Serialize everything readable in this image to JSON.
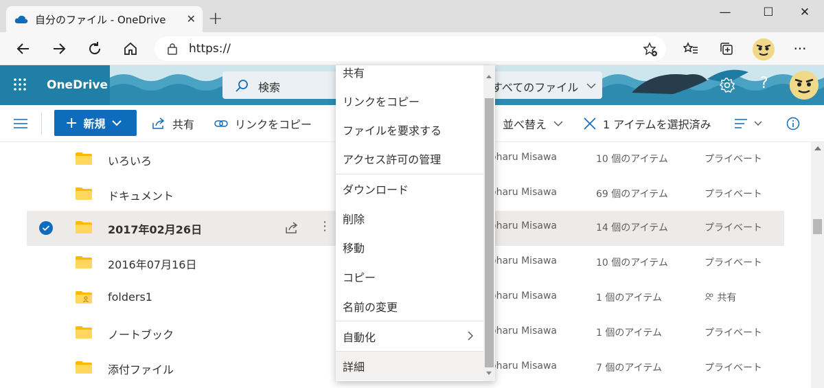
{
  "browser": {
    "tab_title": "自分のファイル - OneDrive",
    "address": "https://",
    "new_tab": "+"
  },
  "header": {
    "brand": "OneDrive",
    "search_label": "検索",
    "search_scope": "すべてのファイル"
  },
  "commands": {
    "new_label": "新規",
    "share_label": "共有",
    "copy_link_label": "リンクをコピー",
    "sort_label": "並べ替え",
    "selection_label": "1 アイテムを選択済み"
  },
  "files": [
    {
      "name": "いろいろ",
      "owner": "oharu Misawa",
      "count": "10 個のアイテム",
      "sharing": "プライベート"
    },
    {
      "name": "ドキュメント",
      "owner": "oharu Misawa",
      "count": "69 個のアイテム",
      "sharing": "プライベート"
    },
    {
      "name": "2017年02月26日",
      "owner": "oharu Misawa",
      "count": "14 個のアイテム",
      "sharing": "プライベート"
    },
    {
      "name": "2016年07月16日",
      "owner": "oharu Misawa",
      "count": "10 個のアイテム",
      "sharing": "プライベート"
    },
    {
      "name": "folders1",
      "owner": "oharu Misawa",
      "count": "1 個のアイテム",
      "sharing": "共有"
    },
    {
      "name": "ノートブック",
      "owner": "oharu Misawa",
      "count": "1 個のアイテム",
      "sharing": "プライベート"
    },
    {
      "name": "添付ファイル",
      "owner": "oharu Misawa",
      "count": "7 個のアイテム",
      "sharing": "プライベート"
    }
  ],
  "context_menu": {
    "items": [
      "共有",
      "リンクをコピー",
      "ファイルを要求する",
      "アクセス許可の管理",
      "ダウンロード",
      "削除",
      "移動",
      "コピー",
      "名前の変更",
      "自動化",
      "詳細"
    ]
  },
  "colors": {
    "accent": "#0f6cbd",
    "header": "#1f7fa6",
    "selected_row": "#edebe9"
  }
}
